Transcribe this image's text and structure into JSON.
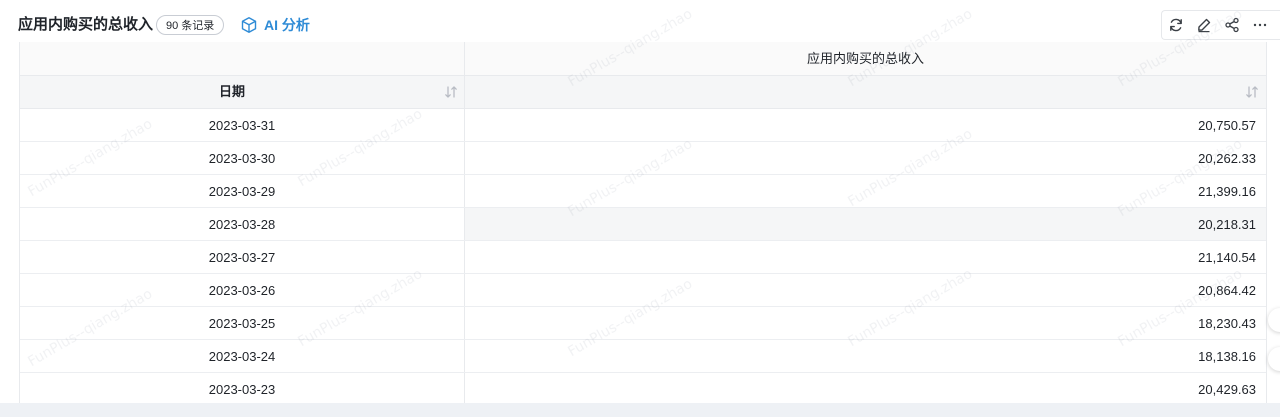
{
  "header": {
    "title": "应用内购买的总收入",
    "record_badge": "90 条记录",
    "ai_button_label": "AI 分析"
  },
  "toolbar": {
    "icons": [
      "refresh-icon",
      "edit-icon",
      "share-icon",
      "more-icon"
    ],
    "more_glyph": "···"
  },
  "table": {
    "group_header": "应用内购买的总收入",
    "columns": [
      {
        "key": "date",
        "label": "日期"
      },
      {
        "key": "value",
        "label": ""
      }
    ],
    "rows": [
      {
        "date": "2023-03-31",
        "value": "20,750.57"
      },
      {
        "date": "2023-03-30",
        "value": "20,262.33"
      },
      {
        "date": "2023-03-29",
        "value": "21,399.16"
      },
      {
        "date": "2023-03-28",
        "value": "20,218.31"
      },
      {
        "date": "2023-03-27",
        "value": "21,140.54"
      },
      {
        "date": "2023-03-26",
        "value": "20,864.42"
      },
      {
        "date": "2023-03-25",
        "value": "18,230.43"
      },
      {
        "date": "2023-03-24",
        "value": "18,138.16"
      },
      {
        "date": "2023-03-23",
        "value": "20,429.63"
      }
    ],
    "hovered_row_index": 3
  },
  "watermark": {
    "text": "FunPlus--qiang.zhao"
  },
  "colors": {
    "accent": "#2e8bd6",
    "text": "#1f2329",
    "border": "#e8eaed",
    "header_bg": "#f5f6f7",
    "page_bg": "#eef1f5"
  }
}
